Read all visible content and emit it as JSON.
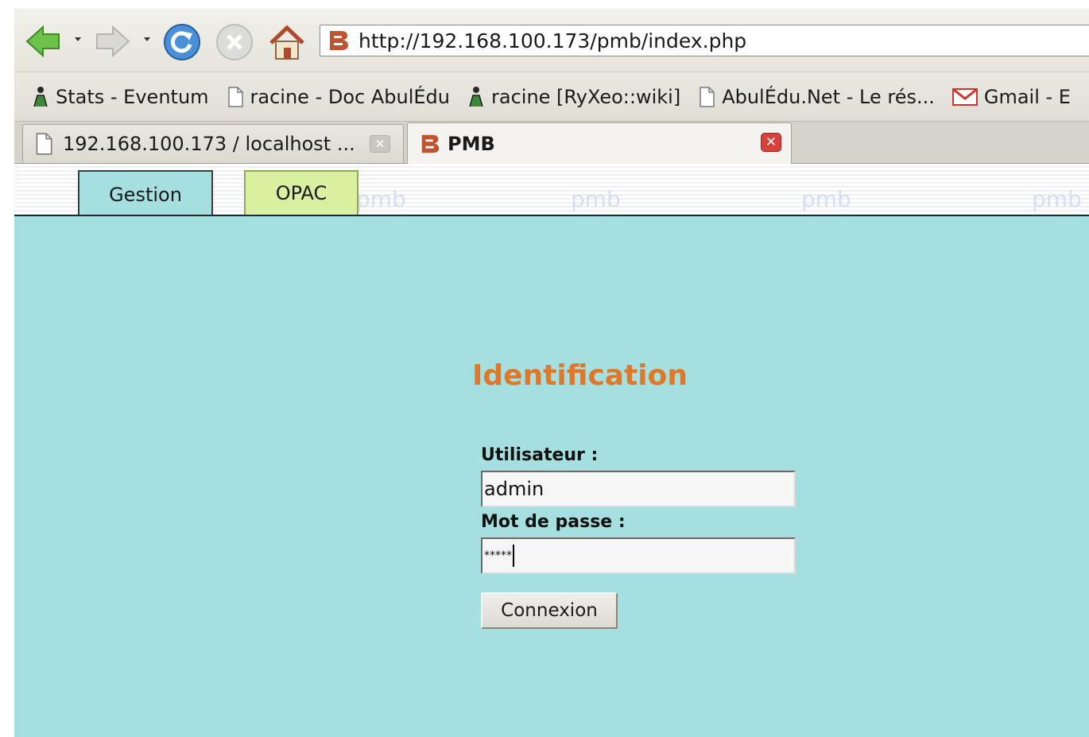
{
  "browser": {
    "url": "http://192.168.100.173/pmb/index.php",
    "bookmarks": [
      {
        "label": "Stats - Eventum",
        "icon": "people-icon"
      },
      {
        "label": "racine - Doc AbulÉdu",
        "icon": "page-icon"
      },
      {
        "label": "racine [RyXeo::wiki]",
        "icon": "people-icon"
      },
      {
        "label": "AbulÉdu.Net - Le rés...",
        "icon": "page-icon"
      },
      {
        "label": "Gmail - E",
        "icon": "gmail-icon"
      }
    ],
    "tabs": [
      {
        "label": "192.168.100.173 / localhost ...",
        "icon": "page-icon"
      },
      {
        "label": "PMB",
        "icon": "pmb-icon"
      }
    ]
  },
  "page": {
    "nav_tabs": [
      {
        "label": "Gestion"
      },
      {
        "label": "OPAC"
      }
    ],
    "watermark": "pmb",
    "title": "Identification",
    "form": {
      "user_label": "Utilisateur :",
      "user_value": "admin",
      "pass_label": "Mot de passe :",
      "pass_value": "*****",
      "submit_label": "Connexion"
    }
  },
  "colors": {
    "page_background": "#a6dfdf",
    "title": "#e0782a",
    "opac_tab": "#d9f0a0"
  }
}
